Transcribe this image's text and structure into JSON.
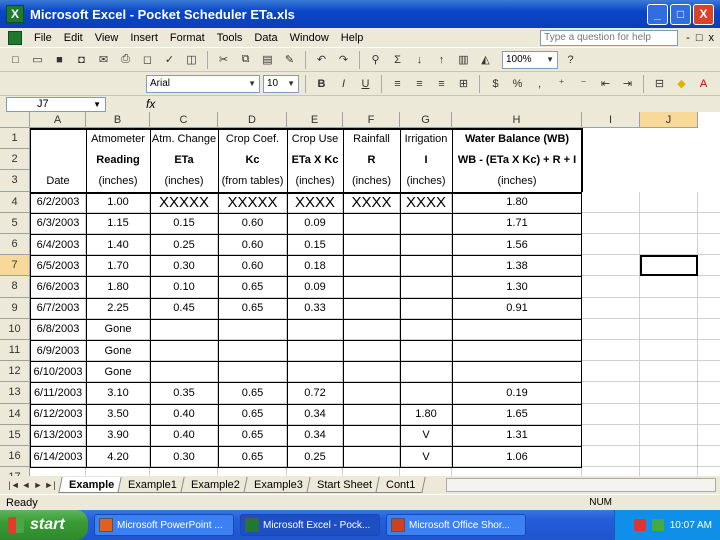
{
  "window": {
    "title": "Microsoft Excel - Pocket Scheduler ETa.xls",
    "min": "_",
    "max": "□",
    "close": "X"
  },
  "menu": {
    "items": [
      "File",
      "Edit",
      "View",
      "Insert",
      "Format",
      "Tools",
      "Data",
      "Window",
      "Help"
    ],
    "ask_placeholder": "Type a question for help",
    "doc_controls": [
      "-",
      "□",
      "x"
    ]
  },
  "toolbar": {
    "zoom": "100%",
    "font": "Arial",
    "size": "10",
    "bold": "B",
    "italic": "I",
    "underline": "U"
  },
  "formula_bar": {
    "name_box": "J7",
    "fx": "fx"
  },
  "columns": [
    "A",
    "B",
    "C",
    "D",
    "E",
    "F",
    "G",
    "H",
    "I",
    "J"
  ],
  "rows": [
    "1",
    "2",
    "3",
    "4",
    "5",
    "6",
    "7",
    "8",
    "9",
    "10",
    "11",
    "12",
    "13",
    "14",
    "15",
    "16",
    "17"
  ],
  "header": {
    "row1": [
      "",
      "Atmometer",
      "Atm. Change",
      "Crop Coef.",
      "Crop Use",
      "Rainfall",
      "Irrigation",
      "Water Balance (WB)"
    ],
    "row2": [
      "",
      "Reading",
      "ETa",
      "Kc",
      "ETa X Kc",
      "R",
      "I",
      "WB - (ETa X Kc) + R + I"
    ],
    "row3": [
      "Date",
      "(inches)",
      "(inches)",
      "(from tables)",
      "(inches)",
      "(inches)",
      "(inches)",
      "(inches)"
    ]
  },
  "data": [
    [
      "6/2/2003",
      "1.00",
      "XXXXX",
      "XXXXX",
      "XXXX",
      "XXXX",
      "XXXX",
      "1.80"
    ],
    [
      "6/3/2003",
      "1.15",
      "0.15",
      "0.60",
      "0.09",
      "",
      "",
      "1.71"
    ],
    [
      "6/4/2003",
      "1.40",
      "0.25",
      "0.60",
      "0.15",
      "",
      "",
      "1.56"
    ],
    [
      "6/5/2003",
      "1.70",
      "0.30",
      "0.60",
      "0.18",
      "",
      "",
      "1.38"
    ],
    [
      "6/6/2003",
      "1.80",
      "0.10",
      "0.65",
      "0.09",
      "",
      "",
      "1.30"
    ],
    [
      "6/7/2003",
      "2.25",
      "0.45",
      "0.65",
      "0.33",
      "",
      "",
      "0.91"
    ],
    [
      "6/8/2003",
      "Gone",
      "",
      "",
      "",
      "",
      "",
      ""
    ],
    [
      "6/9/2003",
      "Gone",
      "",
      "",
      "",
      "",
      "",
      ""
    ],
    [
      "6/10/2003",
      "Gone",
      "",
      "",
      "",
      "",
      "",
      ""
    ],
    [
      "6/11/2003",
      "3.10",
      "0.35",
      "0.65",
      "0.72",
      "",
      "",
      "0.19"
    ],
    [
      "6/12/2003",
      "3.50",
      "0.40",
      "0.65",
      "0.34",
      "",
      "1.80",
      "1.65"
    ],
    [
      "6/13/2003",
      "3.90",
      "0.40",
      "0.65",
      "0.34",
      "",
      "V",
      "1.31"
    ],
    [
      "6/14/2003",
      "4.20",
      "0.30",
      "0.65",
      "0.25",
      "",
      "V",
      "1.06"
    ]
  ],
  "sheet_tabs": [
    "Example",
    "Example1",
    "Example2",
    "Example3",
    "Start Sheet",
    "Cont1"
  ],
  "active_tab": "Example",
  "status": {
    "ready": "Ready",
    "num": "NUM"
  },
  "taskbar": {
    "start": "start",
    "tasks": [
      "Microsoft PowerPoint ...",
      "Microsoft Excel - Pock...",
      "Microsoft Office Shor..."
    ],
    "clock": "10:07 AM"
  }
}
